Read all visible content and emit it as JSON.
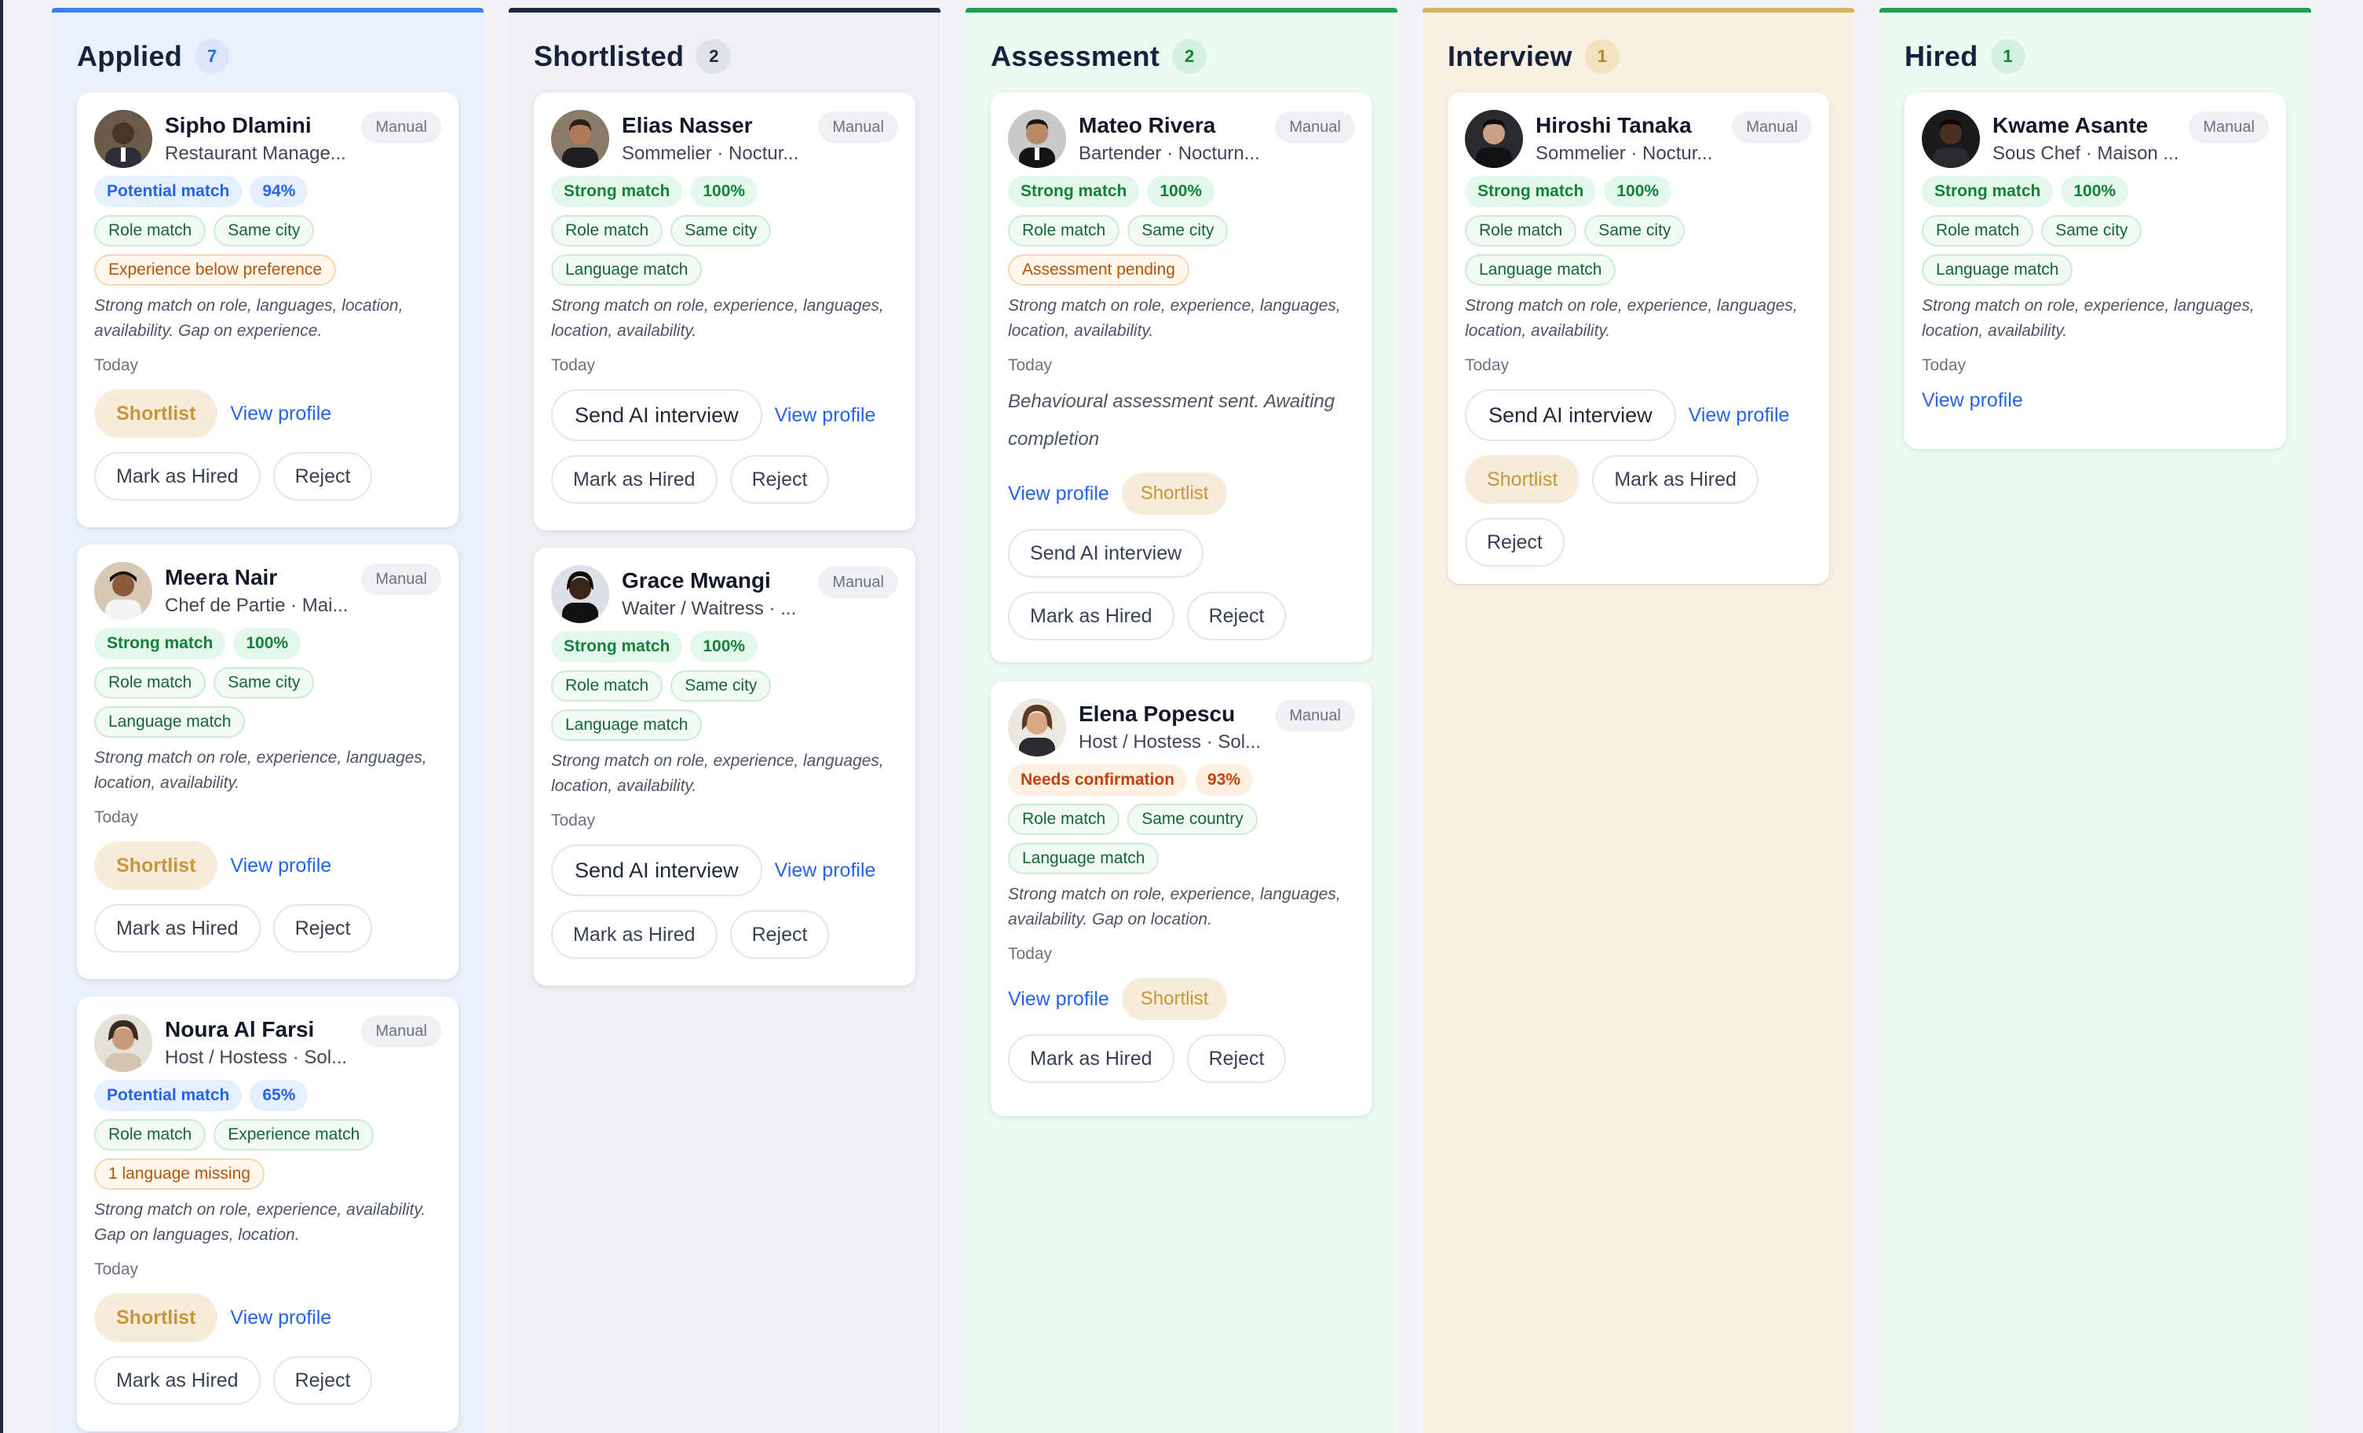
{
  "manual_label": "Manual",
  "actions": {
    "shortlist": "Shortlist",
    "view_profile": "View profile",
    "mark_hired": "Mark as Hired",
    "reject": "Reject",
    "send_ai": "Send AI interview"
  },
  "columns": [
    {
      "title": "Applied",
      "count": "7",
      "accent": "#3b82f6",
      "cards": [
        {
          "name": "Sipho Dlamini",
          "role": "Restaurant Manage...",
          "match": "Potential match",
          "score": "94%",
          "tags_row1": [
            "Role match",
            "Same city"
          ],
          "tags_row2": [
            "Experience below preference"
          ],
          "summary": "Strong match on role, languages, location, availability. Gap on experience.",
          "date": "Today"
        },
        {
          "name": "Meera Nair",
          "role": "Chef de Partie · Mai...",
          "match": "Strong match",
          "score": "100%",
          "tags_row1": [
            "Role match",
            "Same city"
          ],
          "tags_row2": [
            "Language match"
          ],
          "summary": "Strong match on role, experience, languages, location, availability.",
          "date": "Today"
        },
        {
          "name": "Noura Al Farsi",
          "role": "Host / Hostess · Sol...",
          "match": "Potential match",
          "score": "65%",
          "tags_row1": [
            "Role match",
            "Experience match"
          ],
          "tags_row2": [
            "1 language missing"
          ],
          "summary": "Strong match on role, experience, availability. Gap on languages, location.",
          "date": "Today"
        }
      ]
    },
    {
      "title": "Shortlisted",
      "count": "2",
      "accent": "#1f2a44",
      "cards": [
        {
          "name": "Elias Nasser",
          "role": "Sommelier · Noctur...",
          "match": "Strong match",
          "score": "100%",
          "tags_row1": [
            "Role match",
            "Same city"
          ],
          "tags_row2": [
            "Language match"
          ],
          "summary": "Strong match on role, experience, languages, location, availability.",
          "date": "Today"
        },
        {
          "name": "Grace Mwangi",
          "role": "Waiter / Waitress · ...",
          "match": "Strong match",
          "score": "100%",
          "tags_row1": [
            "Role match",
            "Same city"
          ],
          "tags_row2": [
            "Language match"
          ],
          "summary": "Strong match on role, experience, languages, location, availability.",
          "date": "Today"
        }
      ]
    },
    {
      "title": "Assessment",
      "count": "2",
      "accent": "#16a34a",
      "cards": [
        {
          "name": "Mateo Rivera",
          "role": "Bartender · Nocturn...",
          "match": "Strong match",
          "score": "100%",
          "tags_row1": [
            "Role match",
            "Same city"
          ],
          "tags_row2": [
            "Assessment pending"
          ],
          "summary": "Strong match on role, experience, languages, location, availability.",
          "date": "Today",
          "note": "Behavioural assessment sent. Awaiting completion"
        },
        {
          "name": "Elena Popescu",
          "role": "Host / Hostess · Sol...",
          "match": "Needs confirmation",
          "score": "93%",
          "tags_row1": [
            "Role match",
            "Same country"
          ],
          "tags_row2": [
            "Language match"
          ],
          "summary": "Strong match on role, experience, languages, availability. Gap on location.",
          "date": "Today"
        }
      ]
    },
    {
      "title": "Interview",
      "count": "1",
      "accent": "#d6b15e",
      "cards": [
        {
          "name": "Hiroshi Tanaka",
          "role": "Sommelier · Noctur...",
          "match": "Strong match",
          "score": "100%",
          "tags_row1": [
            "Role match",
            "Same city"
          ],
          "tags_row2": [
            "Language match"
          ],
          "summary": "Strong match on role, experience, languages, location, availability.",
          "date": "Today"
        }
      ]
    },
    {
      "title": "Hired",
      "count": "1",
      "accent": "#16a34a",
      "cards": [
        {
          "name": "Kwame Asante",
          "role": "Sous Chef · Maison ...",
          "match": "Strong match",
          "score": "100%",
          "tags_row1": [
            "Role match",
            "Same city"
          ],
          "tags_row2": [
            "Language match"
          ],
          "summary": "Strong match on role, experience, languages, location, availability.",
          "date": "Today"
        }
      ]
    }
  ]
}
